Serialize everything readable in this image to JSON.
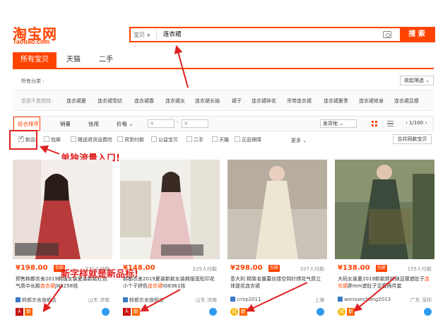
{
  "header": {
    "logo_cn": "淘宝网",
    "logo_en": "Taobao.com",
    "search_type": "宝贝",
    "search_query": "连衣裙",
    "search_button": "搜 索"
  },
  "tabs": [
    {
      "label": "所有宝贝",
      "active": true
    },
    {
      "label": "天猫",
      "active": false
    },
    {
      "label": "二手",
      "active": false
    }
  ],
  "category": {
    "crumb": "所有分类",
    "filter_button": "收起筛选"
  },
  "related": {
    "label": "您是不是想找:",
    "keywords": [
      "连衣裙夏",
      "连衣裙雪纺",
      "连衣裙春",
      "连衣裙女",
      "连衣裙长袖",
      "裙子",
      "连衣裙碎花",
      "吊带连衣裙",
      "连衣裙夏季",
      "连衣裙修身",
      "连衣裙显瘦"
    ]
  },
  "sortbar": {
    "items": [
      "综合排序",
      "销量",
      "信用",
      "价格"
    ],
    "price_from": "¥",
    "price_to": "¥",
    "ship_from": "发货地",
    "pager": "1/100"
  },
  "checkbox_filters": [
    {
      "label": "新品",
      "checked": true
    },
    {
      "label": "包邮",
      "checked": false
    },
    {
      "label": "赠送退货运费险",
      "checked": false
    },
    {
      "label": "货到付款",
      "checked": false
    },
    {
      "label": "公益宝贝",
      "checked": false
    },
    {
      "label": "二手",
      "checked": false
    },
    {
      "label": "天猫",
      "checked": false
    },
    {
      "label": "正品保障",
      "checked": false
    }
  ],
  "more_label": "更多",
  "merge_button": "合并同款宝贝",
  "annotations": {
    "entry": "单独流量入口!",
    "new_label": "新字样就是新品标!"
  },
  "products": [
    {
      "price": "¥198.00",
      "tag": "包邮",
      "sold": "231人付款",
      "title_a": "预售韩都衣舍2019韩版女装夏装新款",
      "title_b": "红色气质中长款",
      "title_hl": "连衣裙",
      "title_c": "JN8258钱",
      "shop": "韩都衣舍旗舰店",
      "location": "山东 济南",
      "badge": "",
      "icon_a": "天",
      "icon_b": "新",
      "swatch": "#b93a3a"
    },
    {
      "price": "¥148.00",
      "tag": "",
      "sold": "225人付款",
      "title_a": "韩都衣舍2019夏装新款女装韩版宽松",
      "title_b": "印花小个子拼色",
      "title_hl": "连衣裙",
      "title_c": "IG8361钱",
      "shop": "韩都衣舍旗舰店",
      "location": "山东 济南",
      "badge": "",
      "icon_a": "天",
      "icon_b": "新",
      "swatch": "#e8c3c4"
    },
    {
      "price": "¥298.00",
      "tag": "包邮",
      "sold": "107人付款",
      "title_a": "意大利 精致名媛蕾丝镂空钩针绣花",
      "title_b": "",
      "title_hl": "",
      "title_c": "气质立体提花连衣裙",
      "shop": "crisp2011",
      "location": "上海",
      "badge": "",
      "icon_a": "冠",
      "icon_b": "新",
      "swatch": "#ece6d3"
    },
    {
      "price": "¥138.00",
      "tag": "包邮",
      "sold": "155人付款",
      "title_a": "大码女装夏2019新款胖妹妹显瘦遮肚子",
      "title_b": "",
      "title_hl": "连衣裙",
      "title_c": "胖mm遮肚子显瘦两件套",
      "shop": "wensanchang2013",
      "location": "广东 深圳",
      "badge": "",
      "icon_a": "冠",
      "icon_b": "新",
      "swatch": "#3b4a3a"
    }
  ],
  "colors": {
    "accent": "#ff4400",
    "annotation": "#e02020"
  }
}
